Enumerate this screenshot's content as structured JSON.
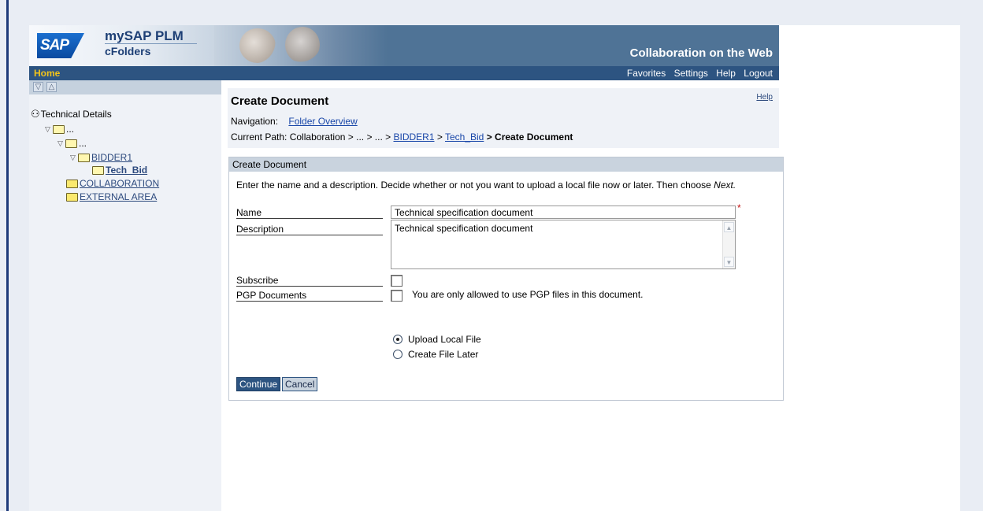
{
  "header": {
    "sap_logo": "SAP",
    "product_title": "mySAP PLM",
    "product_subtitle": "cFolders",
    "tagline": "Collaboration on the Web"
  },
  "navbar": {
    "home": "Home",
    "links": [
      "Favorites",
      "Settings",
      "Help",
      "Logout"
    ]
  },
  "tree": {
    "toolbar": [
      "▽",
      "△"
    ],
    "root": "Technical Details",
    "nodes": {
      "level1": "...",
      "level2": "...",
      "bidder": "BIDDER1",
      "tech_bid": "Tech_Bid",
      "collaboration": "COLLABORATION",
      "external": "EXTERNAL AREA"
    }
  },
  "page": {
    "title": "Create Document",
    "help": "Help",
    "navigation_label": "Navigation:",
    "navigation_link": "Folder Overview",
    "path_label": "Current Path:",
    "path_prefix": "Collaboration > ... > ... >",
    "path_bidder": "BIDDER1",
    "path_sep": ">",
    "path_techbid": "Tech_Bid",
    "path_current": "> Create Document"
  },
  "form": {
    "panel_title": "Create Document",
    "intro_text": "Enter the name and a description. Decide whether or not you want to upload a local file now or later. Then choose",
    "intro_next": "Next.",
    "name_label": "Name",
    "name_value": "Technical specification document",
    "required_mark": "*",
    "description_label": "Description",
    "description_value": "Technical specification document",
    "subscribe_label": "Subscribe",
    "subscribe_checked": false,
    "pgp_label": "PGP Documents",
    "pgp_checked": false,
    "pgp_note": "You are only allowed to use PGP files in this document.",
    "radio_upload": "Upload Local File",
    "radio_later": "Create File Later",
    "selected_radio": "upload",
    "continue_label": "Continue",
    "cancel_label": "Cancel"
  }
}
